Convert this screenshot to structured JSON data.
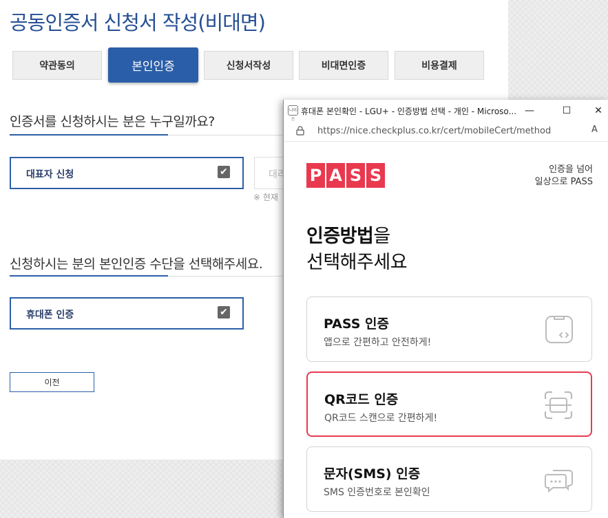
{
  "page": {
    "title": "공동인증서 신청서 작성(비대면)",
    "steps": [
      {
        "label": "약관동의"
      },
      {
        "label": "본인인증"
      },
      {
        "label": "신청서작성"
      },
      {
        "label": "비대면인증"
      },
      {
        "label": "비용결제"
      }
    ],
    "active_step": 1,
    "question1": "인증서를 신청하시는 분은 누구일까요?",
    "option_representative": "대표자 신청",
    "option_agent_partial": "대리",
    "note_partial": "※ 현재",
    "question2": "신청하시는 분의 본인인증 수단을 선택해주세요.",
    "option_phone": "휴대폰 인증",
    "checkmark": "✔",
    "prev_button": "이전"
  },
  "popup": {
    "window_title": "휴대폰 본인확인 - LGU+ - 인증방법 선택 - 개인 - Microso...",
    "favicon_text": "나이스",
    "url": "https://nice.checkplus.co.kr/cert/mobileCert/method",
    "controls": {
      "minimize": "—",
      "maximize": "☐",
      "close": "✕"
    },
    "reader_icon": "A",
    "logo_letters": [
      "P",
      "A",
      "S",
      "S"
    ],
    "tagline_line1": "인증을 넘어",
    "tagline_line2": "일상으로 PASS",
    "heading_bold": "인증방법",
    "heading_rest": "을",
    "heading_line2": "선택해주세요",
    "methods": [
      {
        "title": "PASS 인증",
        "subtitle": "앱으로 간편하고 안전하게!",
        "icon": "phone-code-icon"
      },
      {
        "title": "QR코드 인증",
        "subtitle": "QR코드 스캔으로 간편하게!",
        "icon": "qr-scan-icon"
      },
      {
        "title": "문자(SMS) 인증",
        "subtitle": "SMS 인증번호로 본인확인",
        "icon": "chat-bubbles-icon"
      }
    ],
    "selected_method": 1,
    "accent_color": "#e9394f"
  }
}
